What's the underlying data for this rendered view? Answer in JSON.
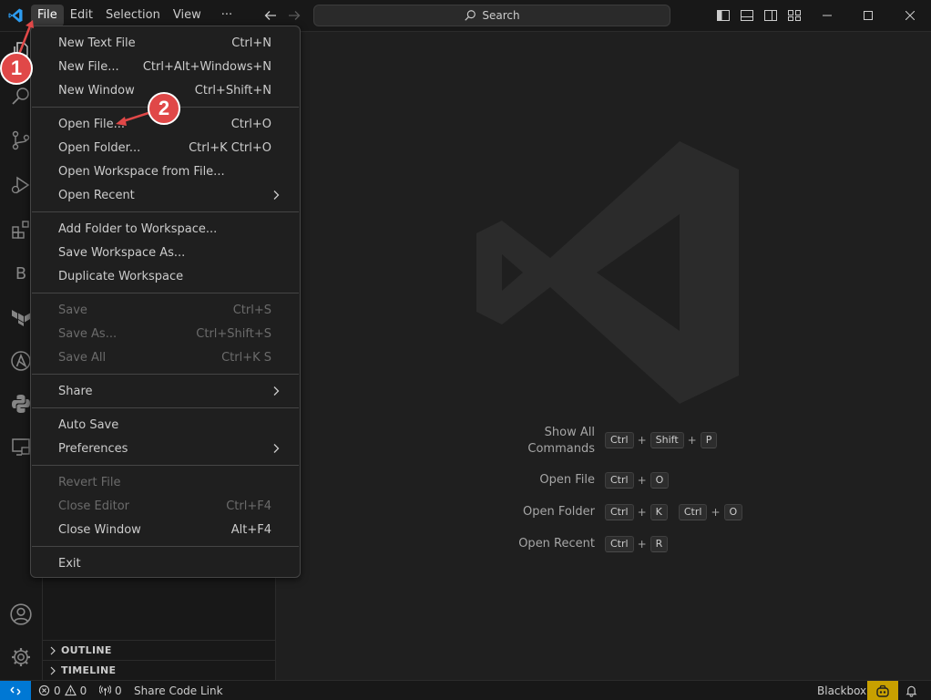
{
  "titlebar": {
    "menus": [
      "File",
      "Edit",
      "Selection",
      "View"
    ],
    "more": "···",
    "search_label": "Search"
  },
  "file_menu": {
    "items": [
      {
        "label": "New Text File",
        "shortcut": "Ctrl+N",
        "enabled": true
      },
      {
        "label": "New File...",
        "shortcut": "Ctrl+Alt+Windows+N",
        "enabled": true
      },
      {
        "label": "New Window",
        "shortcut": "Ctrl+Shift+N",
        "enabled": true
      },
      {
        "label": "Open File...",
        "shortcut": "Ctrl+O",
        "enabled": true
      },
      {
        "label": "Open Folder...",
        "shortcut": "Ctrl+K Ctrl+O",
        "enabled": true
      },
      {
        "label": "Open Workspace from File...",
        "shortcut": "",
        "enabled": true
      },
      {
        "label": "Open Recent",
        "shortcut": "",
        "enabled": true,
        "submenu": true
      },
      {
        "label": "Add Folder to Workspace...",
        "shortcut": "",
        "enabled": true
      },
      {
        "label": "Save Workspace As...",
        "shortcut": "",
        "enabled": true
      },
      {
        "label": "Duplicate Workspace",
        "shortcut": "",
        "enabled": true
      },
      {
        "label": "Save",
        "shortcut": "Ctrl+S",
        "enabled": false
      },
      {
        "label": "Save As...",
        "shortcut": "Ctrl+Shift+S",
        "enabled": false
      },
      {
        "label": "Save All",
        "shortcut": "Ctrl+K S",
        "enabled": false
      },
      {
        "label": "Share",
        "shortcut": "",
        "enabled": true,
        "submenu": true
      },
      {
        "label": "Auto Save",
        "shortcut": "",
        "enabled": true
      },
      {
        "label": "Preferences",
        "shortcut": "",
        "enabled": true,
        "submenu": true
      },
      {
        "label": "Revert File",
        "shortcut": "",
        "enabled": false
      },
      {
        "label": "Close Editor",
        "shortcut": "Ctrl+F4",
        "enabled": false
      },
      {
        "label": "Close Window",
        "shortcut": "Alt+F4",
        "enabled": true
      },
      {
        "label": "Exit",
        "shortcut": "",
        "enabled": true
      }
    ]
  },
  "activitybar": {
    "letter_icon": "B"
  },
  "sidebar": {
    "sections": [
      "OUTLINE",
      "TIMELINE"
    ]
  },
  "editor": {
    "shortcuts": [
      {
        "label_lines": [
          "Show All",
          "Commands"
        ],
        "keys": [
          "Ctrl",
          "+",
          "Shift",
          "+",
          "P"
        ]
      },
      {
        "label_lines": [
          "Open File"
        ],
        "keys": [
          "Ctrl",
          "+",
          "O"
        ]
      },
      {
        "label_lines": [
          "Open Folder"
        ],
        "keys": [
          "Ctrl",
          "+",
          "K",
          "Ctrl",
          "+",
          "O"
        ]
      },
      {
        "label_lines": [
          "Open Recent"
        ],
        "keys": [
          "Ctrl",
          "+",
          "R"
        ]
      }
    ]
  },
  "statusbar": {
    "errors": "0",
    "warnings": "0",
    "ports": "0",
    "share_code_link": "Share Code Link",
    "blackbox": "Blackbox"
  },
  "annotations": {
    "callout_1": "1",
    "callout_2": "2"
  },
  "colors": {
    "accent": "#0078d4",
    "annotation": "#e04848",
    "background": "#1f1f1f",
    "chrome": "#181818"
  }
}
